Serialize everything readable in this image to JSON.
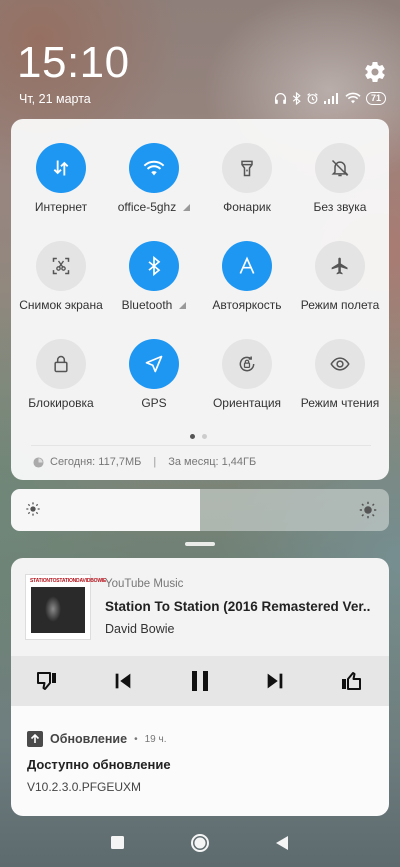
{
  "status": {
    "time": "15:10",
    "date": "Чт, 21 марта",
    "battery": "71",
    "icons": [
      "headphones-icon",
      "bluetooth-icon",
      "alarm-icon",
      "signal-icon",
      "wifi-icon"
    ]
  },
  "quick_settings": {
    "tiles": [
      {
        "label": "Интернет",
        "icon": "mobile-data-icon",
        "active": true
      },
      {
        "label": "office-5ghz",
        "icon": "wifi-icon",
        "active": true
      },
      {
        "label": "Фонарик",
        "icon": "flashlight-icon",
        "active": false
      },
      {
        "label": "Без звука",
        "icon": "mute-bell-icon",
        "active": false
      },
      {
        "label": "Снимок экрана",
        "icon": "screenshot-icon",
        "active": false
      },
      {
        "label": "Bluetooth",
        "icon": "bluetooth-icon",
        "active": true
      },
      {
        "label": "Автояркость",
        "icon": "auto-brightness-icon",
        "active": true
      },
      {
        "label": "Режим полета",
        "icon": "airplane-icon",
        "active": false
      },
      {
        "label": "Блокировка",
        "icon": "lock-icon",
        "active": false
      },
      {
        "label": "GPS",
        "icon": "gps-icon",
        "active": true
      },
      {
        "label": "Ориентация",
        "icon": "rotation-lock-icon",
        "active": false
      },
      {
        "label": "Режим чтения",
        "icon": "eye-icon",
        "active": false
      }
    ],
    "page_count": 2,
    "current_page": 1,
    "usage_today": "Сегодня: 117,7МБ",
    "usage_separator": "|",
    "usage_month": "За месяц: 1,44ГБ"
  },
  "brightness": {
    "level": 0.5
  },
  "media": {
    "app": "YouTube Music",
    "track": "Station To Station (2016 Remastered Ver..",
    "artist": "David Bowie",
    "album_art_text": "STATIONTOSTATIONDAVIDBOWIE",
    "controls": [
      "thumbs-down-icon",
      "previous-icon",
      "pause-icon",
      "next-icon",
      "thumbs-up-icon"
    ]
  },
  "update": {
    "app": "Обновление",
    "dot": "•",
    "time": "19 ч.",
    "title": "Доступно обновление",
    "text": "V10.2.3.0.PFGEUXM"
  },
  "colors": {
    "accent": "#1e97f3",
    "tile_off": "#e4e4e4",
    "dot_active": "#555555",
    "dot_inactive": "#cccccc"
  }
}
